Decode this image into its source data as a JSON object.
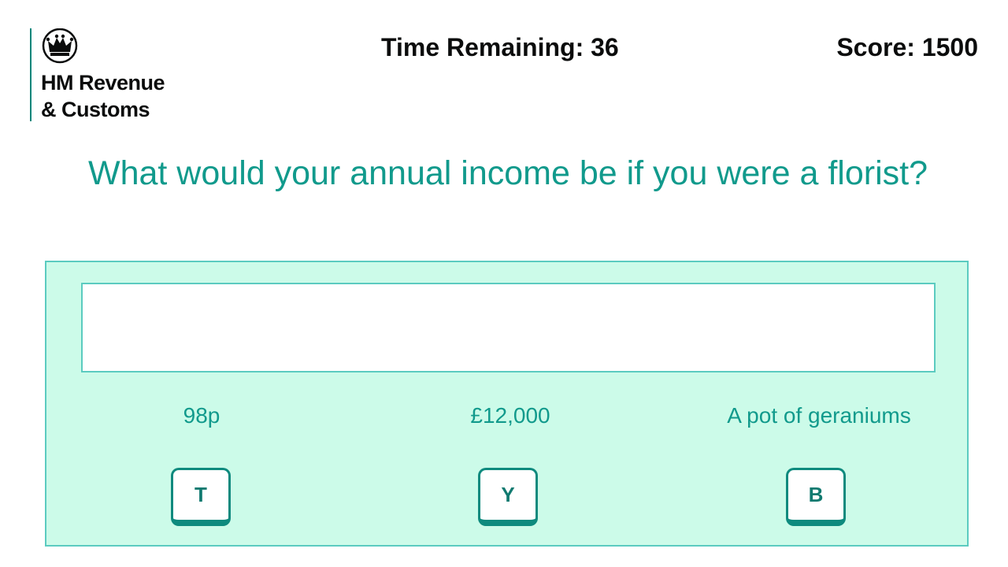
{
  "logo": {
    "icon": "crown-icon",
    "line1": "HM Revenue",
    "line2": "& Customs"
  },
  "header": {
    "timer_text": "Time Remaining: 36",
    "score_text": "Score: 1500"
  },
  "question": {
    "text": "What would your annual income be if you were a florist?"
  },
  "answer_input": {
    "value": ""
  },
  "options": [
    {
      "label": "98p",
      "key": "T"
    },
    {
      "label": "£12,000",
      "key": "Y"
    },
    {
      "label": "A pot of geraniums",
      "key": "B"
    }
  ],
  "colors": {
    "accent": "#119a8c",
    "panel_bg": "#ccfbe9",
    "panel_border": "#5bcbc0",
    "text_dark": "#0b0c0c"
  }
}
